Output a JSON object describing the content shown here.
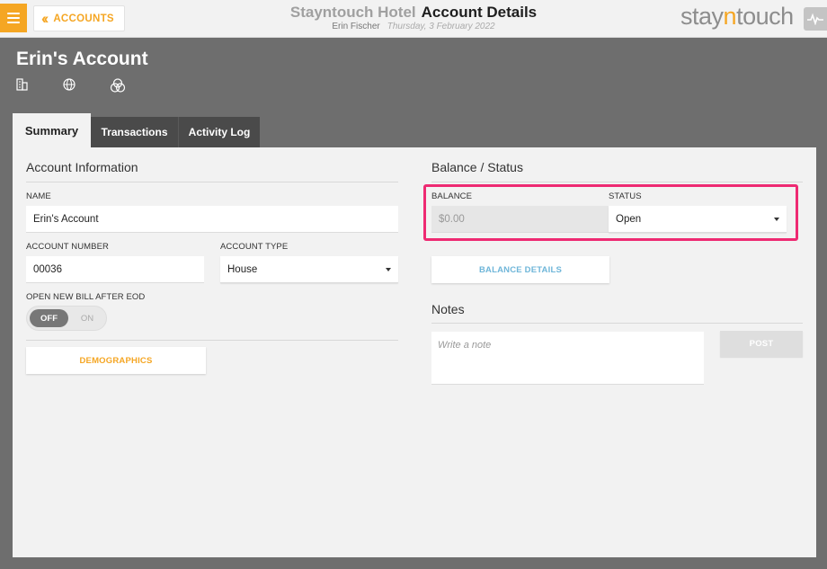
{
  "header": {
    "back_label": "ACCOUNTS",
    "hotel_name": "Stayntouch Hotel",
    "page_title": "Account Details",
    "user_name": "Erin Fischer",
    "date": "Thursday, 3 February 2022",
    "logo_prefix": "stay",
    "logo_n": "n",
    "logo_suffix": "touch"
  },
  "account": {
    "title": "Erin's Account"
  },
  "tabs": [
    {
      "label": "Summary",
      "active": true
    },
    {
      "label": "Transactions",
      "active": false
    },
    {
      "label": "Activity Log",
      "active": false
    }
  ],
  "account_info": {
    "section_title": "Account Information",
    "name_label": "NAME",
    "name_value": "Erin's Account",
    "number_label": "ACCOUNT NUMBER",
    "number_value": "00036",
    "type_label": "ACCOUNT TYPE",
    "type_value": "House",
    "eod_label": "OPEN NEW BILL AFTER EOD",
    "toggle_off": "OFF",
    "toggle_on": "ON",
    "toggle_state": "off",
    "demographics_button": "DEMOGRAPHICS"
  },
  "balance_status": {
    "section_title": "Balance / Status",
    "balance_label": "BALANCE",
    "balance_value": "$0.00",
    "status_label": "STATUS",
    "status_value": "Open",
    "balance_details_button": "BALANCE DETAILS"
  },
  "notes": {
    "section_title": "Notes",
    "placeholder": "Write a note",
    "post_button": "POST"
  },
  "colors": {
    "accent": "#f5a623",
    "highlight": "#ee2a72",
    "link_blue": "#6fb6d9",
    "background": "#6e6e6e",
    "panel": "#f2f2f2"
  }
}
